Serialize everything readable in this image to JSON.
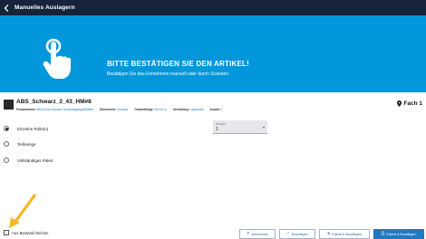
{
  "header": {
    "title": "Manuelles Auslagern"
  },
  "banner": {
    "title": "BITTE BESTÄTIGEN SIE DEN ARTIKEL!",
    "subtitle": "Bestätigen Sie das Entnehmen manuell oder durch Scannen."
  },
  "article": {
    "name": "ABS_Schwarz_2_43_HM#8",
    "meta": [
      {
        "label": "Produktname:",
        "value": "ABS Kunst-Schwarz Demontagstag-Bleibtrei"
      },
      {
        "label": "Dokumente:",
        "value": "Schwarz"
      },
      {
        "label": "Gesamtlänge:",
        "value": "500,00 m"
      },
      {
        "label": "Verwaltung:",
        "value": "Lagerware"
      },
      {
        "label": "Anzahl:",
        "value": "1"
      }
    ],
    "location": "Fach 1"
  },
  "options": [
    {
      "label": "Einzelne Rolle(n)",
      "checked": true
    },
    {
      "label": "Teilmenge",
      "checked": false
    },
    {
      "label": "Vollständiges Paket",
      "checked": false
    }
  ],
  "quantity": {
    "label": "Anzahl",
    "value": "1"
  },
  "checkbox": {
    "label": "Aus Bestand löschen",
    "checked": false
  },
  "buttons": {
    "cancel": "Abbrechen",
    "confirm": "Bestätigen",
    "label_confirm": "Etikett & Bestätigen",
    "label_confirm_primary": "Etikett & Bestätigen"
  },
  "colors": {
    "header_bg": "#16233a",
    "banner_bg": "#0296db",
    "primary": "#1f78c1",
    "annotation_arrow": "#f2b92a"
  },
  "icons": {
    "back": "chevron-left-icon",
    "banner": "hand-tap-icon",
    "location": "map-pin-icon",
    "cancel": "close-icon",
    "confirm": "check-icon",
    "label": "tag-icon",
    "print": "printer-icon"
  }
}
